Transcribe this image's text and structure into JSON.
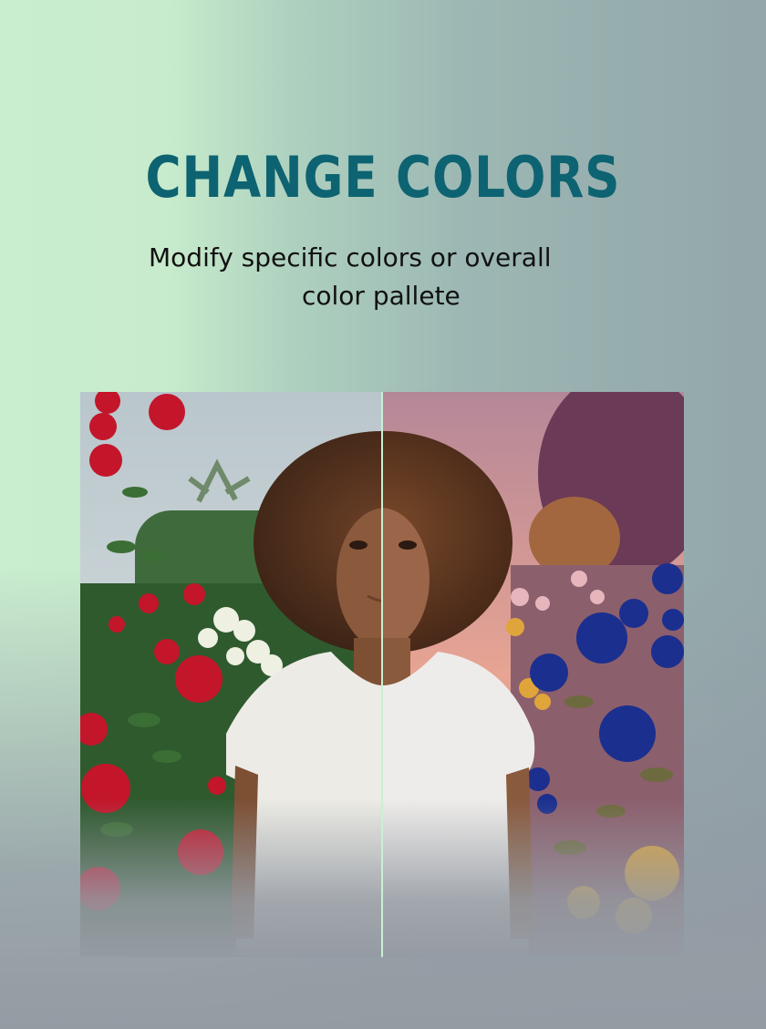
{
  "header": {
    "title": "CHANGE COLORS",
    "subtitle_line1": "Modify specific colors or overall",
    "subtitle_line2": "color pallete"
  },
  "comparison": {
    "left_variant": "original",
    "right_variant": "recolored",
    "divider_position": 0.5
  },
  "colors": {
    "title": "#0d6371",
    "subtitle": "#111111",
    "divider": "#c9f0d2",
    "bg_left": "#c9edcf",
    "bg_right": "#93a7aa",
    "bg_bottom": "#959ba3"
  }
}
